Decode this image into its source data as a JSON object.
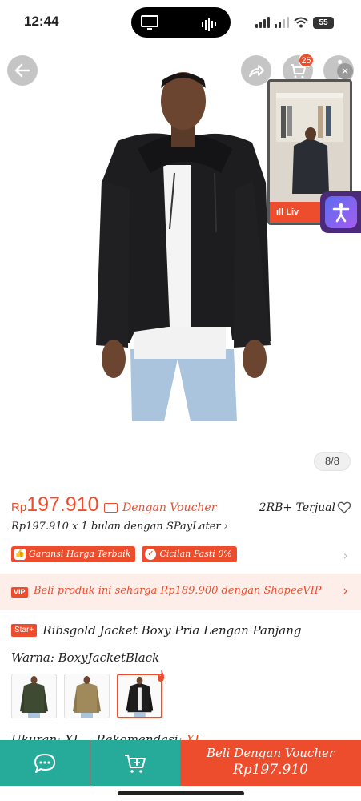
{
  "status_bar": {
    "time": "12:44",
    "battery": "55"
  },
  "nav": {
    "cart_count": "25",
    "live_label": "Liv"
  },
  "gallery": {
    "counter": "8/8"
  },
  "price": {
    "currency": "Rp",
    "amount": "197.910",
    "voucher_text": "Dengan Voucher",
    "sold": "2RB+ Terjual",
    "paylater": "Rp197.910 x 1 bulan dengan SPayLater ›"
  },
  "badges": [
    {
      "label": "Garansi Harga Terbaik",
      "icon": "thumb-icon"
    },
    {
      "label": "Cicilan Pasti 0%",
      "icon": "check-circle-icon"
    }
  ],
  "vip": {
    "tag": "VIP",
    "text": "Beli produk ini seharga Rp189.900 dengan ShopeeVIP"
  },
  "product": {
    "star_tag": "Star+",
    "title": "Ribsgold Jacket Boxy Pria Lengan Panjang"
  },
  "variant": {
    "label": "Warna: BoxyJacketBlack",
    "swatches": [
      {
        "name": "green",
        "color": "#3f4a33"
      },
      {
        "name": "tan",
        "color": "#a08a5c"
      },
      {
        "name": "black",
        "color": "#1e1e1e"
      }
    ]
  },
  "size": {
    "label": "Ukuran: XL",
    "reco_label": "Rekomendasi:",
    "reco_value": "XL"
  },
  "bottom": {
    "buy_line1": "Beli Dengan Voucher",
    "buy_line2": "Rp197.910"
  },
  "colors": {
    "accent": "#ee4d2d",
    "teal": "#26aa99",
    "vip_bg": "#fdeeea"
  }
}
